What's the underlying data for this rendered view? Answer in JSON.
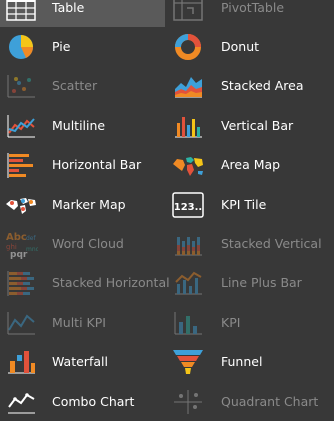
{
  "chart_types": [
    {
      "label": "Table",
      "icon": "table-icon",
      "enabled": true,
      "selected": true
    },
    {
      "label": "PivotTable",
      "icon": "pivot-table-icon",
      "enabled": false
    },
    {
      "label": "Pie",
      "icon": "pie-icon",
      "enabled": true
    },
    {
      "label": "Donut",
      "icon": "donut-icon",
      "enabled": true
    },
    {
      "label": "Scatter",
      "icon": "scatter-icon",
      "enabled": false
    },
    {
      "label": "Stacked Area",
      "icon": "stacked-area-icon",
      "enabled": true
    },
    {
      "label": "Multiline",
      "icon": "multiline-icon",
      "enabled": true
    },
    {
      "label": "Vertical Bar",
      "icon": "vertical-bar-icon",
      "enabled": true
    },
    {
      "label": "Horizontal Bar",
      "icon": "horizontal-bar-icon",
      "enabled": true
    },
    {
      "label": "Area Map",
      "icon": "area-map-icon",
      "enabled": true
    },
    {
      "label": "Marker Map",
      "icon": "marker-map-icon",
      "enabled": true
    },
    {
      "label": "KPI Tile",
      "icon": "kpi-tile-icon",
      "enabled": true
    },
    {
      "label": "Word Cloud",
      "icon": "word-cloud-icon",
      "enabled": false
    },
    {
      "label": "Stacked Vertical",
      "icon": "stacked-vertical-icon",
      "enabled": false
    },
    {
      "label": "Stacked Horizontal",
      "icon": "stacked-horizontal-icon",
      "enabled": false
    },
    {
      "label": "Line Plus Bar",
      "icon": "line-plus-bar-icon",
      "enabled": false
    },
    {
      "label": "Multi KPI",
      "icon": "multi-kpi-icon",
      "enabled": false
    },
    {
      "label": "KPI",
      "icon": "kpi-icon",
      "enabled": false
    },
    {
      "label": "Waterfall",
      "icon": "waterfall-icon",
      "enabled": true
    },
    {
      "label": "Funnel",
      "icon": "funnel-icon",
      "enabled": true
    },
    {
      "label": "Combo Chart",
      "icon": "combo-chart-icon",
      "enabled": true
    },
    {
      "label": "Quadrant Chart",
      "icon": "quadrant-chart-icon",
      "enabled": false
    }
  ],
  "kpi_tile_text": "123..",
  "word_cloud_text": [
    "Abc",
    "def",
    "ghi",
    "pqr",
    "mno"
  ],
  "colors": {
    "background": "#383838",
    "selected": "#5a5a5a",
    "text": "#ffffff",
    "text_disabled": "#8a8a8a",
    "orange": "#f08a24",
    "red": "#e2523b",
    "blue": "#3ea0d9",
    "yellow": "#f5c518",
    "teal": "#2bb3a5"
  }
}
